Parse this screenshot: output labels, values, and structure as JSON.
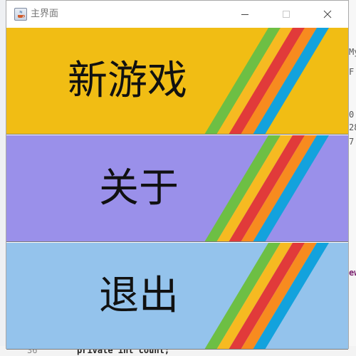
{
  "window": {
    "title": "主界面"
  },
  "buttons": [
    {
      "label": "新游戏",
      "color": "#f1bd14"
    },
    {
      "label": "关于",
      "color": "#9a90ea"
    },
    {
      "label": "退出",
      "color": "#94c3ec"
    }
  ],
  "stripe_colors": [
    "#6dbf44",
    "#f6ba21",
    "#e13a3a",
    "#f78b1f",
    "#13a2dd"
  ],
  "background": {
    "right_fragments": [
      "My",
      "F",
      "0",
      "28",
      "7",
      "ew"
    ],
    "bottom_line_number": "36",
    "bottom_code": "private int count;"
  }
}
